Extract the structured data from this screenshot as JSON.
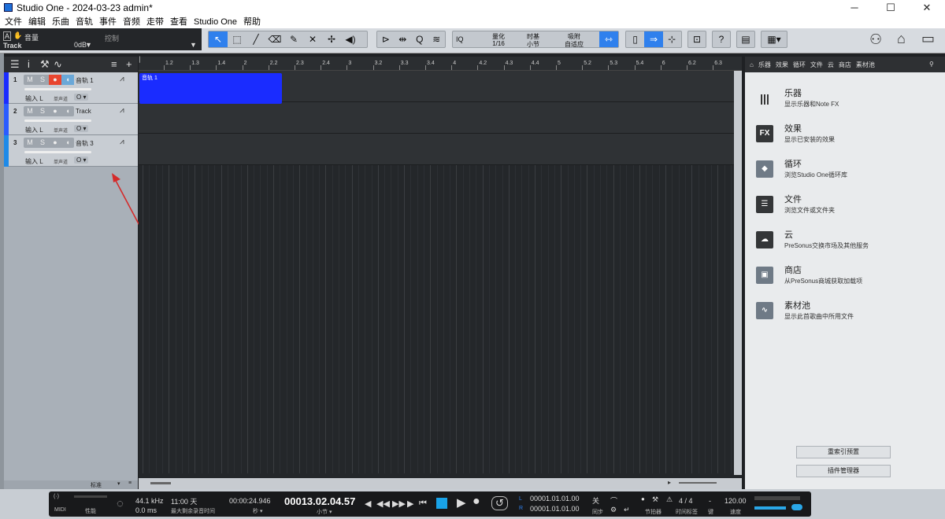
{
  "window": {
    "title": "Studio One - 2024-03-23 admin*",
    "minimize": "─",
    "maximize": "☐",
    "close": "✕"
  },
  "menu": [
    "文件",
    "编辑",
    "乐曲",
    "音轨",
    "事件",
    "音频",
    "走带",
    "查看",
    "Studio One",
    "帮助"
  ],
  "track_info": {
    "label_a": "音量",
    "label_track": "Track",
    "gain": "0dB",
    "control": "控制"
  },
  "quantize": {
    "q_label": "IQ",
    "quant_title": "量化",
    "quant_value": "1/16",
    "time_title": "时基",
    "time_value": "小节",
    "snap_title": "吸附",
    "snap_value": "自适应"
  },
  "ruler": [
    "1.2",
    "1.3",
    "1.4",
    "2",
    "2.2",
    "2.3",
    "2.4",
    "3",
    "3.2",
    "3.3",
    "3.4",
    "4",
    "4.2",
    "4.3",
    "4.4",
    "5",
    "5.2",
    "5.3",
    "5.4",
    "6",
    "6.2",
    "6.3"
  ],
  "tracks": [
    {
      "num": "1",
      "name": "音轨 1",
      "color": "#1a2cff",
      "input": "输入 L",
      "monitor": "单声道",
      "o": "O ▾"
    },
    {
      "num": "2",
      "name": "Track",
      "color": "#2a5cff",
      "input": "输入 L",
      "monitor": "单声道",
      "o": "O ▾"
    },
    {
      "num": "3",
      "name": "音轨 3",
      "color": "#1e8ae8",
      "input": "输入 L",
      "monitor": "单声道",
      "o": "O ▾"
    }
  ],
  "event": {
    "label": "音轨 1"
  },
  "left_footer": {
    "mode": "标准"
  },
  "browser": {
    "tabs": [
      "乐器",
      "效果",
      "循环",
      "文件",
      "云",
      "商店",
      "素材池"
    ],
    "items": [
      {
        "title": "乐器",
        "desc": "显示乐器和Note FX",
        "icon": "|||"
      },
      {
        "title": "效果",
        "desc": "显示已安装的效果",
        "icon": "FX"
      },
      {
        "title": "循环",
        "desc": "浏览Studio One循环库",
        "icon": "◆"
      },
      {
        "title": "文件",
        "desc": "浏览文件或文件夹",
        "icon": "☰"
      },
      {
        "title": "云",
        "desc": "PreSonus交换市场及其他服务",
        "icon": "☁"
      },
      {
        "title": "商店",
        "desc": "从PreSonus商城获取加载项",
        "icon": "▣"
      },
      {
        "title": "素材池",
        "desc": "显示此首歌曲中所用文件",
        "icon": "∿"
      }
    ],
    "btn_reindex": "重索引预置",
    "btn_plugins": "插件管理器"
  },
  "transport": {
    "midi": "MIDI",
    "perf": "性能",
    "rate": "44.1 kHz",
    "latency": "0.0 ms",
    "rec_time": "11:00 天",
    "rec_label": "最大剩余录音时间",
    "seconds": "00:00:24.946",
    "seconds_label": "秒 ▾",
    "bars": "00013.02.04.57",
    "bars_label": "小节 ▾",
    "loop_l": "00001.01.01.00",
    "loop_r": "00001.01.01.00",
    "sync_state": "关",
    "sync_label": "同步",
    "metronome_label": "节拍器",
    "signature": "4 / 4",
    "signature_label": "时间标签",
    "key_label": "键",
    "key_value": "-",
    "tempo": "120.00",
    "tempo_label": "速度"
  }
}
